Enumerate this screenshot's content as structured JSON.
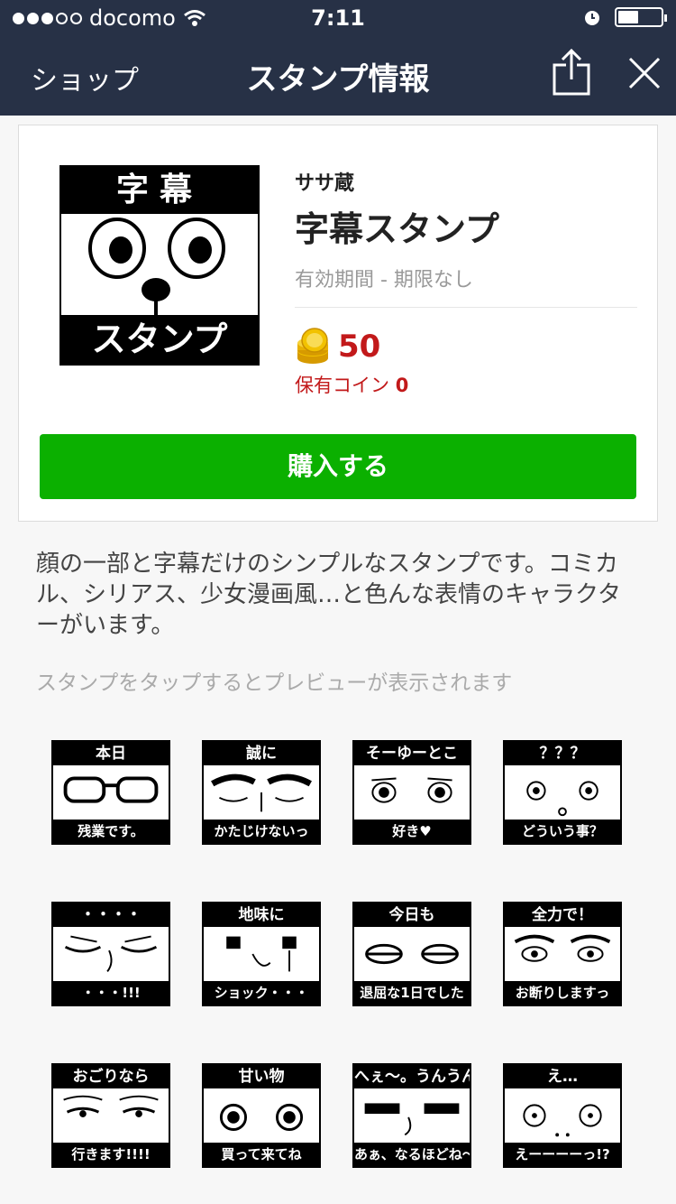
{
  "status_bar": {
    "carrier": "docomo",
    "time": "7:11",
    "signal_bars": 3,
    "battery_percent": 45
  },
  "nav": {
    "back_label": "ショップ",
    "title": "スタンプ情報",
    "share_icon": "share-icon",
    "close_icon": "close-icon"
  },
  "product": {
    "thumbnail": {
      "top_text": "字幕",
      "bottom_text": "スタンプ"
    },
    "author": "ササ蔵",
    "name": "字幕スタンプ",
    "validity": "有効期間 - 期限なし",
    "price": "50",
    "owned_label": "保有コイン",
    "owned_value": "0",
    "buy_label": "購入する"
  },
  "colors": {
    "nav_bg": "#273146",
    "buy_green": "#0bb000",
    "price_red": "#c2191a"
  },
  "description": "顔の一部と字幕だけのシンプルなスタンプです。コミカル、シリアス、少女漫画風…と色んな表情のキャラクターがいます。",
  "preview_hint": "スタンプをタップするとプレビューが表示されます",
  "stamps": [
    {
      "top": "本日",
      "bottom": "残業です。"
    },
    {
      "top": "誠に",
      "bottom": "かたじけないっ"
    },
    {
      "top": "そーゆーとこ",
      "bottom": "好き♥"
    },
    {
      "top": "？？？",
      "bottom": "どういう事？"
    },
    {
      "top": "・・・・",
      "bottom": "・・・!!!"
    },
    {
      "top": "地味に",
      "bottom": "ショック・・・"
    },
    {
      "top": "今日も",
      "bottom": "退屈な1日でした"
    },
    {
      "top": "全力で！",
      "bottom": "お断りしますっ"
    },
    {
      "top": "おごりなら",
      "bottom": "行きます!!!!"
    },
    {
      "top": "甘い物",
      "bottom": "買って来てね"
    },
    {
      "top": "へぇ〜。うんうん。",
      "bottom": "あぁ、なるほどね〜"
    },
    {
      "top": "え…",
      "bottom": "えーーーーっ!?"
    }
  ]
}
